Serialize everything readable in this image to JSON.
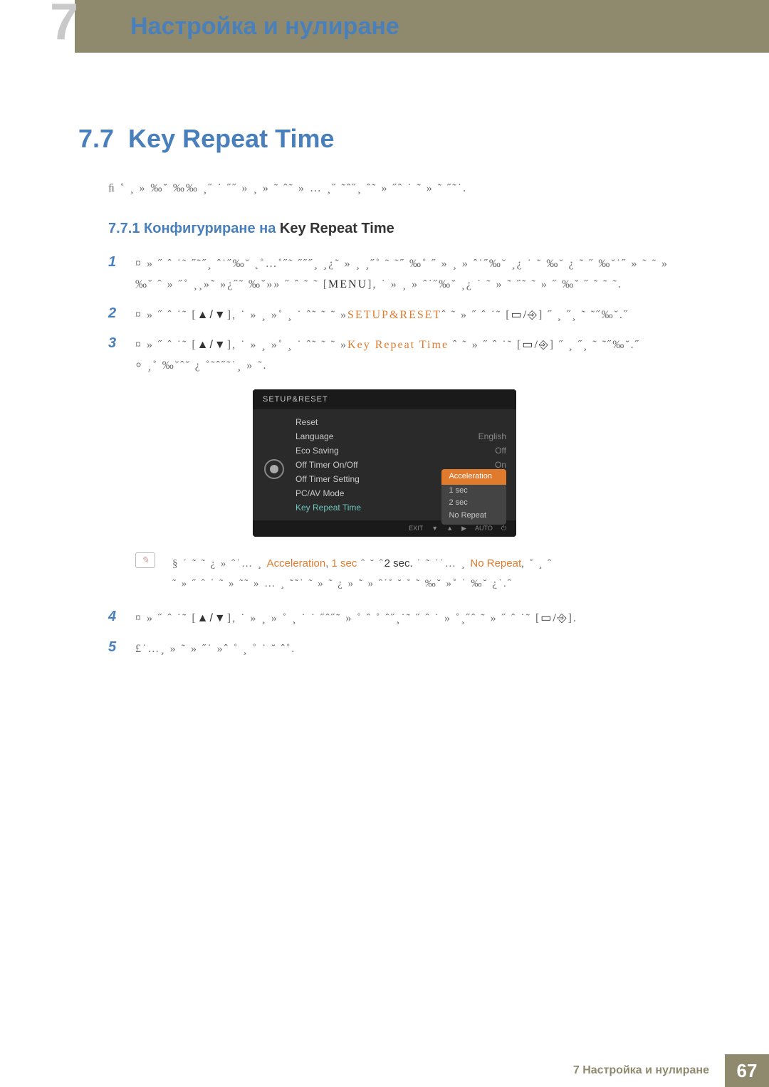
{
  "header": {
    "chapter_num": "7",
    "title": "Настройка и нулиране"
  },
  "section": {
    "number": "7.7",
    "title": "Key Repeat Time"
  },
  "intro": "ﬁ ˚ ¸ » ‰˘ ‰‰ ¸˝ ˙ ˝˝ » ¸ » ˜ ˆ˜ » … ¸˝ ˜ˆ˝¸ ˆ˜ » ˝ˆ ˙ ˜ » ˜ ˝˜˙.",
  "subsection": {
    "number": "7.7.1",
    "label_blue": "Конфигуриране на",
    "label_black": "Key Repeat Time"
  },
  "steps": {
    "s1": {
      "num": "1",
      "text_a": "¤ » ˝ ˆ ˙˜ ˝˜˝¸ ˆ˙˝‰˘ ˛˚…˚˝˜ ˝˝˝¸ ¸¿˜ » ¸ ¸˝˚ ˜ ˜˝ ‰˚ ˝ » ¸ » ˆ˙˝‰˘ ¸¿ ˙ ˜ ‰˘ ¿ ˜ ˝ ‰˘˙˝ » ˜ ˜ » ‰˘ ˆ » ˝˚ ¸¸»˜ »¿˝˜ ‰˘»» ˝ ˆ ˜ ˜",
      "menu": "MENU",
      "text_b": "], ˙ » ¸ » ˆ˙˝‰˘ ¸¿ ˙ ˜ » ˜ ˝˜ ˜ » ˝ ‰˘ ˝ ˜ ˜ ˜."
    },
    "s2": {
      "num": "2",
      "text_a": "¤ » ˝ ˆ ˙˜ [",
      "arrows": "▲/▼",
      "text_b": "], ˙ » ¸ »˚ ¸ ˙ ˆ˜ ˜ ˜ »",
      "orange1": "SETUP&RESET",
      "text_c": "ˆ ˜ » ˝ ˆ ˙˜ [",
      "icon": "▭/⎆",
      "text_d": "] ˝ ¸ ˝¸ ˜ ˜˝‰˘.˝"
    },
    "s3": {
      "num": "3",
      "text_a": "¤ » ˝ ˆ ˙˜ [",
      "arrows": "▲/▼",
      "text_b": "], ˙ » ¸ »˚ ¸ ˙ ˆ˜ ˜ ˜ »",
      "orange1": "Key Repeat Time",
      "text_c": " ˆ ˜ » ˝ ˆ ˙˜ [",
      "icon": "▭/⎆",
      "text_d": "] ˝ ¸ ˝¸ ˜ ˜˝‰˘.˝",
      "text_e": "⸰       ¸˚ ‰˘ˆ˘  ¿ ˚˜ˆ˝˜˙¸ » ˜."
    },
    "s4": {
      "num": "4",
      "text_a": "¤ » ˝ ˆ ˙˜ [",
      "arrows": "▲/▼",
      "text_b": "], ˙ » ¸ » ˚ ¸ ˙ ˙ ˝ˆ˝˜ » ˚ ˆ ˚ ˆ˝¸˙˜ ˝ ˆ ˙ » ˚¸˝ˆ ˜ » ˝ ˆ ˙˜ [",
      "icon": "▭/⎆",
      "text_c": "]."
    },
    "s5": {
      "num": "5",
      "text_a": "£˙…¸ » ˜ » ˝˙ »ˆ      ˚ ¸ ˚ ˙ ˘ ˆ˚."
    }
  },
  "osd": {
    "title": "SETUP&RESET",
    "rows": [
      {
        "label": "Reset",
        "value": ""
      },
      {
        "label": "Language",
        "value": "English"
      },
      {
        "label": "Eco Saving",
        "value": "Off"
      },
      {
        "label": "Off Timer On/Off",
        "value": "On"
      },
      {
        "label": "Off Timer Setting",
        "value": ""
      },
      {
        "label": "PC/AV Mode",
        "value": ""
      },
      {
        "label": "Key Repeat Time",
        "value": ""
      }
    ],
    "dropdown": [
      "Acceleration",
      "1 sec",
      "2 sec",
      "No Repeat"
    ],
    "footer": [
      "EXIT",
      "▼",
      "▲",
      "▶",
      "AUTO",
      "⏻"
    ]
  },
  "note": {
    "line1_a": "§ ˙ ˜ ˜ ¿ » ˆ˙… ¸ ",
    "orange1": "Acceleration",
    "sep1": ", ",
    "orange2": "1 sec",
    "mid": " ˆ ˘ ˆ",
    "black1": "2 sec.",
    "line1_b": " ˙ ˜ ˙˙… ¸ ",
    "orange3": "No Repeat",
    "line1_c": ", ˚ ¸ ˆ",
    "line2": "˜ » ˝ ˆ ˙ ˜ » ˜˜ » … ¸ ˜˜˙ ˜ » ˜ ¿ » ˜ » ˆ˙˚ ˘ ˚ ˜ ‰˘ »˚ ˙ ‰˘ ¿˙.ˆ"
  },
  "footer": {
    "text": "7 Настройка и нулиране",
    "page": "67"
  }
}
